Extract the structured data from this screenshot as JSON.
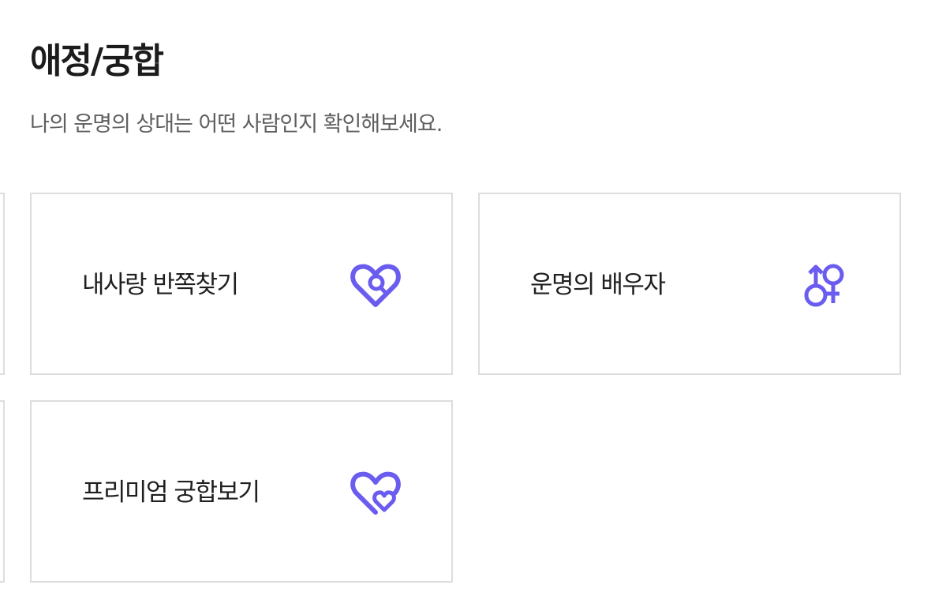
{
  "section": {
    "title": "애정/궁합",
    "description": "나의 운명의 상대는 어떤 사람인지 확인해보세요."
  },
  "colors": {
    "accent": "#6b5cf0",
    "border": "#dddddd",
    "title": "#1c1c1c",
    "description": "#5f5f5f"
  },
  "cards": [
    {
      "label": "내사랑 반쪽찾기",
      "icon": "heart-search-icon"
    },
    {
      "label": "운명의 배우자",
      "icon": "gender-symbols-icon"
    },
    {
      "label": "프리미엄 궁합보기",
      "icon": "double-heart-icon"
    }
  ]
}
